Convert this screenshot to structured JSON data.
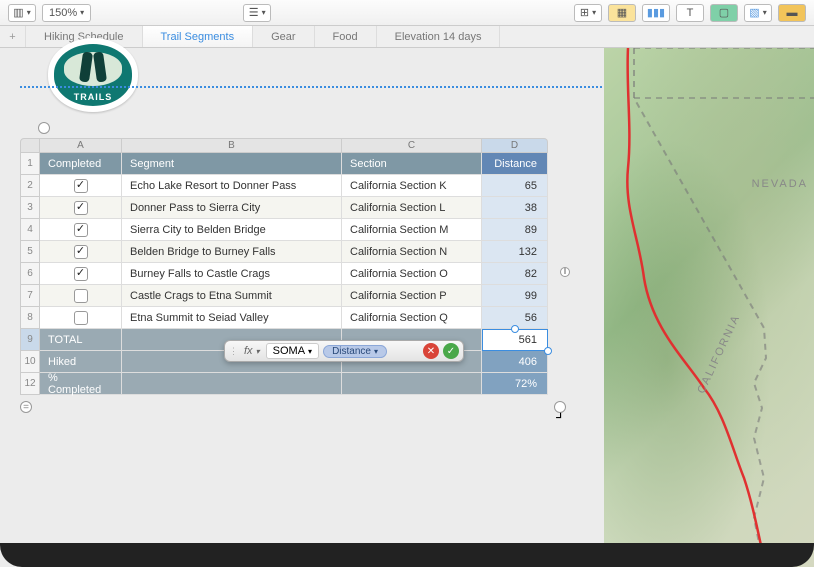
{
  "toolbar": {
    "zoom": "150%",
    "view_icon": "sidebar-icon",
    "list_icon": "list-icon"
  },
  "tabs": [
    {
      "label": "Hiking Schedule",
      "active": false
    },
    {
      "label": "Trail Segments",
      "active": true
    },
    {
      "label": "Gear",
      "active": false
    },
    {
      "label": "Food",
      "active": false
    },
    {
      "label": "Elevation 14 days",
      "active": false
    }
  ],
  "logo": {
    "text": "TRAILS"
  },
  "columns": {
    "letters": [
      "A",
      "B",
      "C",
      "D"
    ],
    "headers": [
      "Completed",
      "Segment",
      "Section",
      "Distance"
    ],
    "selected": "D"
  },
  "rows": [
    {
      "n": "2",
      "done": true,
      "segment": "Echo Lake Resort to Donner Pass",
      "section": "California Section K",
      "dist": "65"
    },
    {
      "n": "3",
      "done": true,
      "segment": "Donner Pass to Sierra City",
      "section": "California Section L",
      "dist": "38"
    },
    {
      "n": "4",
      "done": true,
      "segment": "Sierra City to Belden Bridge",
      "section": "California Section M",
      "dist": "89"
    },
    {
      "n": "5",
      "done": true,
      "segment": "Belden Bridge to Burney Falls",
      "section": "California Section N",
      "dist": "132"
    },
    {
      "n": "6",
      "done": true,
      "segment": "Burney Falls to Castle Crags",
      "section": "California Section O",
      "dist": "82"
    },
    {
      "n": "7",
      "done": false,
      "segment": "Castle Crags to Etna Summit",
      "section": "California Section P",
      "dist": "99"
    },
    {
      "n": "8",
      "done": false,
      "segment": "Etna Summit to Seiad Valley",
      "section": "California Section Q",
      "dist": "56"
    }
  ],
  "footers": [
    {
      "n": "9",
      "label": "TOTAL",
      "dist": "561",
      "active": true
    },
    {
      "n": "10",
      "label": "Hiked",
      "dist": "406",
      "active": false
    },
    {
      "n": "12",
      "label": "% Completed",
      "dist": "72%",
      "active": false
    }
  ],
  "formula": {
    "fx": "fx",
    "fn": "SOMA",
    "token": "Distance"
  },
  "map": {
    "label1": "NEVADA",
    "label2": "CALIFORNIA"
  }
}
